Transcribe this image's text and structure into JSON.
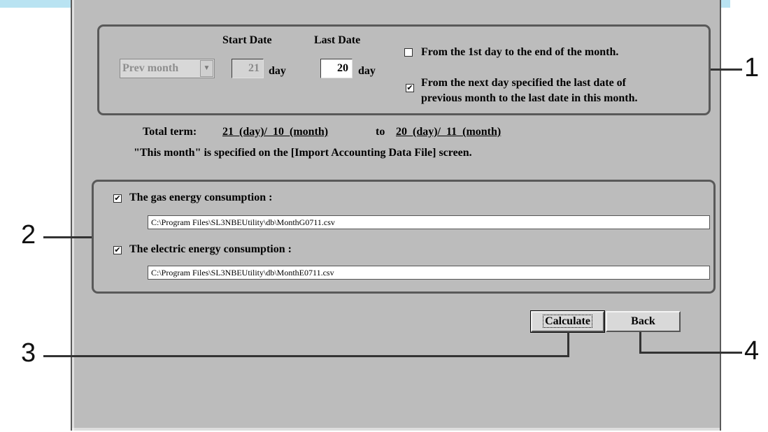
{
  "period": {
    "start_date_header": "Start Date",
    "last_date_header": "Last Date",
    "month_select_value": "Prev month",
    "start_day_value": "21",
    "last_day_value": "20",
    "day_label": "day",
    "option_full_month": {
      "label": "From the 1st day to the end of the month.",
      "checked": false
    },
    "option_next_day": {
      "label_line1": "From the next day specified the last date of",
      "label_line2": "previous month to the last date in this month.",
      "checked": true
    }
  },
  "term": {
    "label": "Total term:",
    "start": "21  (day)/  10  (month)",
    "to": "to",
    "end": "20  (day)/  11  (month)",
    "note": "\"This month\" is specified on the [Import Accounting Data File] screen."
  },
  "consumption": {
    "gas": {
      "label": "The gas energy consumption :",
      "checked": true,
      "path": "C:\\Program Files\\SL3NBEUtility\\db\\MonthG0711.csv"
    },
    "electric": {
      "label": "The electric energy consumption :",
      "checked": true,
      "path": "C:\\Program Files\\SL3NBEUtility\\db\\MonthE0711.csv"
    }
  },
  "buttons": {
    "calculate": "Calculate",
    "back": "Back"
  },
  "callouts": {
    "c1": "1",
    "c2": "2",
    "c3": "3",
    "c4": "4"
  },
  "icons": {
    "checkbox_checked": "✔",
    "dropdown": "▼"
  }
}
